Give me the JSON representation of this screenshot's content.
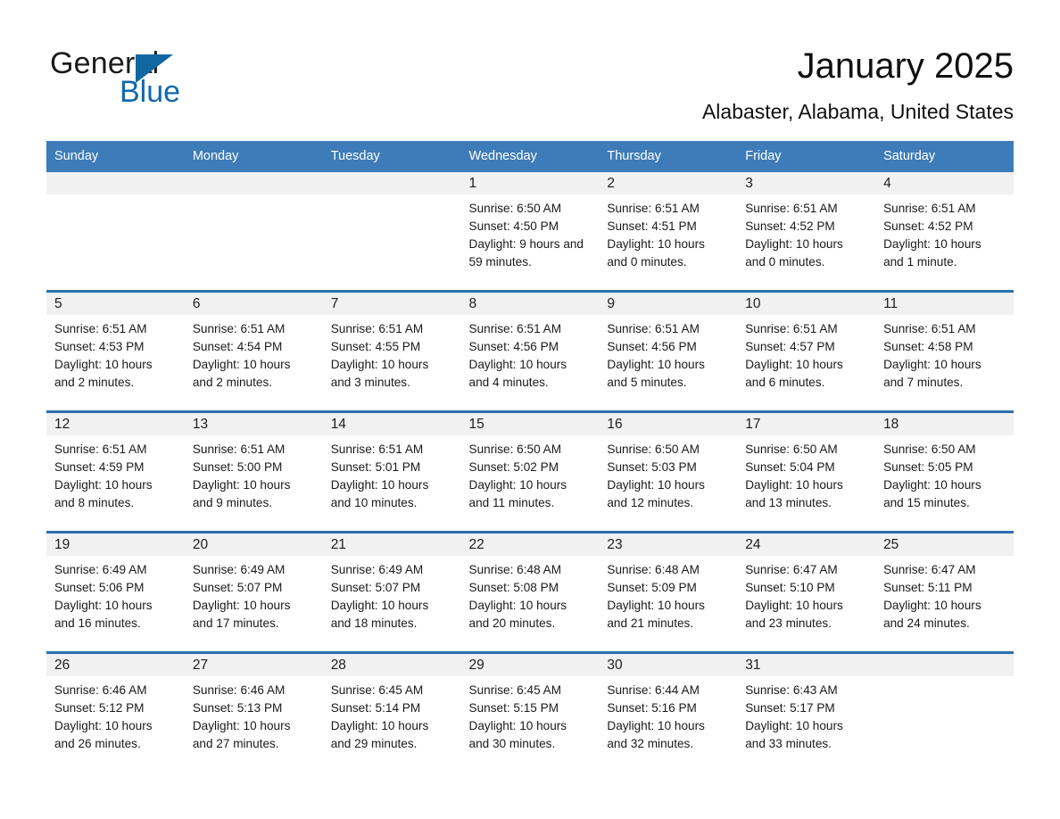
{
  "brand": {
    "name_part1": "General",
    "name_part2": "Blue",
    "accent_color": "#1268ad",
    "triangle_icon": "triangle-right-icon"
  },
  "header": {
    "title": "January 2025",
    "location": "Alabaster, Alabama, United States"
  },
  "calendar": {
    "header_background": "#3d7cb8",
    "row_border_color": "#2e6fad",
    "daynum_band_background": "#f1f1f1",
    "weekday_headers": [
      "Sunday",
      "Monday",
      "Tuesday",
      "Wednesday",
      "Thursday",
      "Friday",
      "Saturday"
    ],
    "weeks": [
      [
        {
          "day": "",
          "sunrise": "",
          "sunset": "",
          "daylight": ""
        },
        {
          "day": "",
          "sunrise": "",
          "sunset": "",
          "daylight": ""
        },
        {
          "day": "",
          "sunrise": "",
          "sunset": "",
          "daylight": ""
        },
        {
          "day": "1",
          "sunrise": "Sunrise: 6:50 AM",
          "sunset": "Sunset: 4:50 PM",
          "daylight": "Daylight: 9 hours and 59 minutes."
        },
        {
          "day": "2",
          "sunrise": "Sunrise: 6:51 AM",
          "sunset": "Sunset: 4:51 PM",
          "daylight": "Daylight: 10 hours and 0 minutes."
        },
        {
          "day": "3",
          "sunrise": "Sunrise: 6:51 AM",
          "sunset": "Sunset: 4:52 PM",
          "daylight": "Daylight: 10 hours and 0 minutes."
        },
        {
          "day": "4",
          "sunrise": "Sunrise: 6:51 AM",
          "sunset": "Sunset: 4:52 PM",
          "daylight": "Daylight: 10 hours and 1 minute."
        }
      ],
      [
        {
          "day": "5",
          "sunrise": "Sunrise: 6:51 AM",
          "sunset": "Sunset: 4:53 PM",
          "daylight": "Daylight: 10 hours and 2 minutes."
        },
        {
          "day": "6",
          "sunrise": "Sunrise: 6:51 AM",
          "sunset": "Sunset: 4:54 PM",
          "daylight": "Daylight: 10 hours and 2 minutes."
        },
        {
          "day": "7",
          "sunrise": "Sunrise: 6:51 AM",
          "sunset": "Sunset: 4:55 PM",
          "daylight": "Daylight: 10 hours and 3 minutes."
        },
        {
          "day": "8",
          "sunrise": "Sunrise: 6:51 AM",
          "sunset": "Sunset: 4:56 PM",
          "daylight": "Daylight: 10 hours and 4 minutes."
        },
        {
          "day": "9",
          "sunrise": "Sunrise: 6:51 AM",
          "sunset": "Sunset: 4:56 PM",
          "daylight": "Daylight: 10 hours and 5 minutes."
        },
        {
          "day": "10",
          "sunrise": "Sunrise: 6:51 AM",
          "sunset": "Sunset: 4:57 PM",
          "daylight": "Daylight: 10 hours and 6 minutes."
        },
        {
          "day": "11",
          "sunrise": "Sunrise: 6:51 AM",
          "sunset": "Sunset: 4:58 PM",
          "daylight": "Daylight: 10 hours and 7 minutes."
        }
      ],
      [
        {
          "day": "12",
          "sunrise": "Sunrise: 6:51 AM",
          "sunset": "Sunset: 4:59 PM",
          "daylight": "Daylight: 10 hours and 8 minutes."
        },
        {
          "day": "13",
          "sunrise": "Sunrise: 6:51 AM",
          "sunset": "Sunset: 5:00 PM",
          "daylight": "Daylight: 10 hours and 9 minutes."
        },
        {
          "day": "14",
          "sunrise": "Sunrise: 6:51 AM",
          "sunset": "Sunset: 5:01 PM",
          "daylight": "Daylight: 10 hours and 10 minutes."
        },
        {
          "day": "15",
          "sunrise": "Sunrise: 6:50 AM",
          "sunset": "Sunset: 5:02 PM",
          "daylight": "Daylight: 10 hours and 11 minutes."
        },
        {
          "day": "16",
          "sunrise": "Sunrise: 6:50 AM",
          "sunset": "Sunset: 5:03 PM",
          "daylight": "Daylight: 10 hours and 12 minutes."
        },
        {
          "day": "17",
          "sunrise": "Sunrise: 6:50 AM",
          "sunset": "Sunset: 5:04 PM",
          "daylight": "Daylight: 10 hours and 13 minutes."
        },
        {
          "day": "18",
          "sunrise": "Sunrise: 6:50 AM",
          "sunset": "Sunset: 5:05 PM",
          "daylight": "Daylight: 10 hours and 15 minutes."
        }
      ],
      [
        {
          "day": "19",
          "sunrise": "Sunrise: 6:49 AM",
          "sunset": "Sunset: 5:06 PM",
          "daylight": "Daylight: 10 hours and 16 minutes."
        },
        {
          "day": "20",
          "sunrise": "Sunrise: 6:49 AM",
          "sunset": "Sunset: 5:07 PM",
          "daylight": "Daylight: 10 hours and 17 minutes."
        },
        {
          "day": "21",
          "sunrise": "Sunrise: 6:49 AM",
          "sunset": "Sunset: 5:07 PM",
          "daylight": "Daylight: 10 hours and 18 minutes."
        },
        {
          "day": "22",
          "sunrise": "Sunrise: 6:48 AM",
          "sunset": "Sunset: 5:08 PM",
          "daylight": "Daylight: 10 hours and 20 minutes."
        },
        {
          "day": "23",
          "sunrise": "Sunrise: 6:48 AM",
          "sunset": "Sunset: 5:09 PM",
          "daylight": "Daylight: 10 hours and 21 minutes."
        },
        {
          "day": "24",
          "sunrise": "Sunrise: 6:47 AM",
          "sunset": "Sunset: 5:10 PM",
          "daylight": "Daylight: 10 hours and 23 minutes."
        },
        {
          "day": "25",
          "sunrise": "Sunrise: 6:47 AM",
          "sunset": "Sunset: 5:11 PM",
          "daylight": "Daylight: 10 hours and 24 minutes."
        }
      ],
      [
        {
          "day": "26",
          "sunrise": "Sunrise: 6:46 AM",
          "sunset": "Sunset: 5:12 PM",
          "daylight": "Daylight: 10 hours and 26 minutes."
        },
        {
          "day": "27",
          "sunrise": "Sunrise: 6:46 AM",
          "sunset": "Sunset: 5:13 PM",
          "daylight": "Daylight: 10 hours and 27 minutes."
        },
        {
          "day": "28",
          "sunrise": "Sunrise: 6:45 AM",
          "sunset": "Sunset: 5:14 PM",
          "daylight": "Daylight: 10 hours and 29 minutes."
        },
        {
          "day": "29",
          "sunrise": "Sunrise: 6:45 AM",
          "sunset": "Sunset: 5:15 PM",
          "daylight": "Daylight: 10 hours and 30 minutes."
        },
        {
          "day": "30",
          "sunrise": "Sunrise: 6:44 AM",
          "sunset": "Sunset: 5:16 PM",
          "daylight": "Daylight: 10 hours and 32 minutes."
        },
        {
          "day": "31",
          "sunrise": "Sunrise: 6:43 AM",
          "sunset": "Sunset: 5:17 PM",
          "daylight": "Daylight: 10 hours and 33 minutes."
        },
        {
          "day": "",
          "sunrise": "",
          "sunset": "",
          "daylight": ""
        }
      ]
    ]
  }
}
